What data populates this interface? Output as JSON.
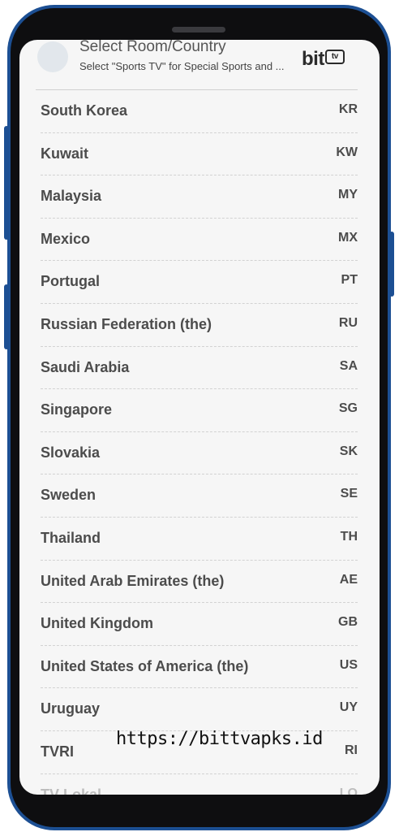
{
  "header": {
    "title": "Select Room/Country",
    "subtitle": "Select \"Sports TV\" for Special Sports and ...",
    "logo_text": "bit",
    "logo_badge": "tv"
  },
  "countries": [
    {
      "name": "South Korea",
      "code": "KR"
    },
    {
      "name": "Kuwait",
      "code": "KW"
    },
    {
      "name": "Malaysia",
      "code": "MY"
    },
    {
      "name": "Mexico",
      "code": "MX"
    },
    {
      "name": "Portugal",
      "code": "PT"
    },
    {
      "name": "Russian Federation (the)",
      "code": "RU"
    },
    {
      "name": "Saudi Arabia",
      "code": "SA"
    },
    {
      "name": "Singapore",
      "code": "SG"
    },
    {
      "name": "Slovakia",
      "code": "SK"
    },
    {
      "name": "Sweden",
      "code": "SE"
    },
    {
      "name": "Thailand",
      "code": "TH"
    },
    {
      "name": "United Arab Emirates (the)",
      "code": "AE"
    },
    {
      "name": "United Kingdom",
      "code": "GB"
    },
    {
      "name": "United States of America (the)",
      "code": "US"
    },
    {
      "name": "Uruguay",
      "code": "UY"
    },
    {
      "name": "TVRI",
      "code": "RI"
    },
    {
      "name": "TV Lokal",
      "code": "LO"
    }
  ],
  "watermark": "https://bittvapks.id",
  "colors": {
    "frame": "#1c4f93",
    "bezel": "#0e0e10",
    "screen": "#f6f6f6",
    "text": "#4c4c4c"
  }
}
